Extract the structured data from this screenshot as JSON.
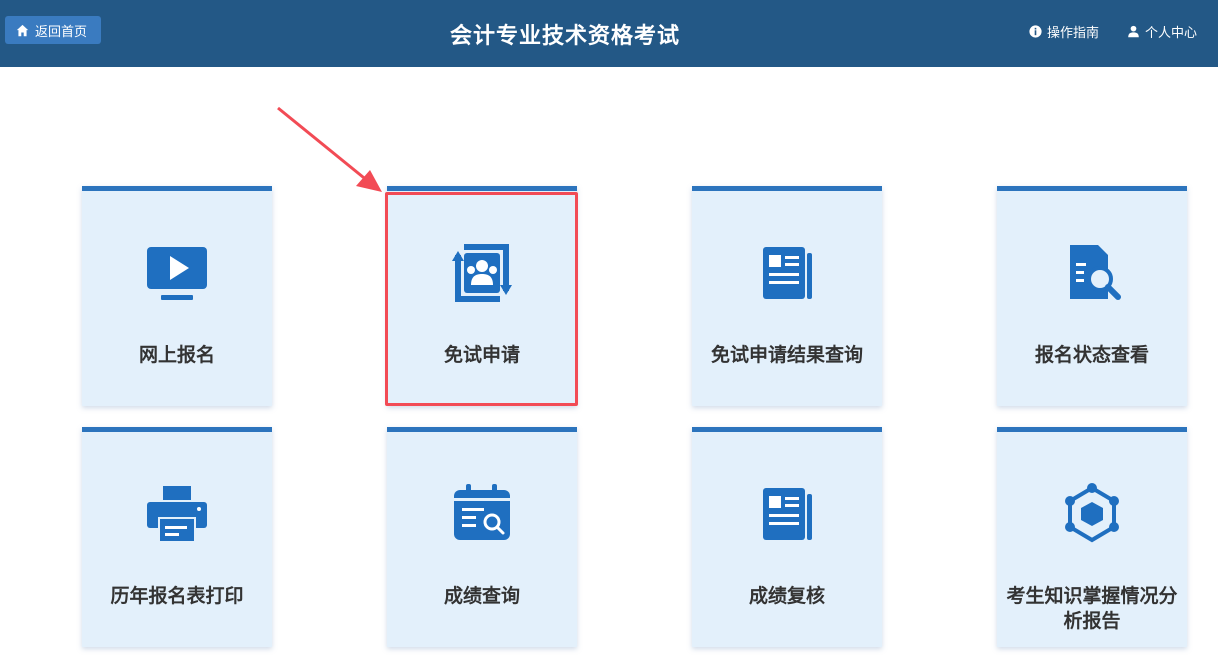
{
  "header": {
    "home_label": "返回首页",
    "title": "会计专业技术资格考试",
    "guide_label": "操作指南",
    "user_label": "个人中心"
  },
  "cards": [
    {
      "label": "网上报名",
      "icon": "monitor-play-icon"
    },
    {
      "label": "免试申请",
      "icon": "group-exchange-icon"
    },
    {
      "label": "免试申请结果查询",
      "icon": "newspaper-icon"
    },
    {
      "label": "报名状态查看",
      "icon": "document-search-icon"
    },
    {
      "label": "历年报名表打印",
      "icon": "printer-icon"
    },
    {
      "label": "成绩查询",
      "icon": "calendar-search-icon"
    },
    {
      "label": "成绩复核",
      "icon": "newspaper-icon"
    },
    {
      "label": "考生知识掌握情况分析报告",
      "icon": "hexagon-network-icon"
    }
  ],
  "colors": {
    "header_bg": "#235886",
    "accent": "#2c74bd",
    "card_bg": "#e3f0fb",
    "highlight": "#f24b55"
  }
}
